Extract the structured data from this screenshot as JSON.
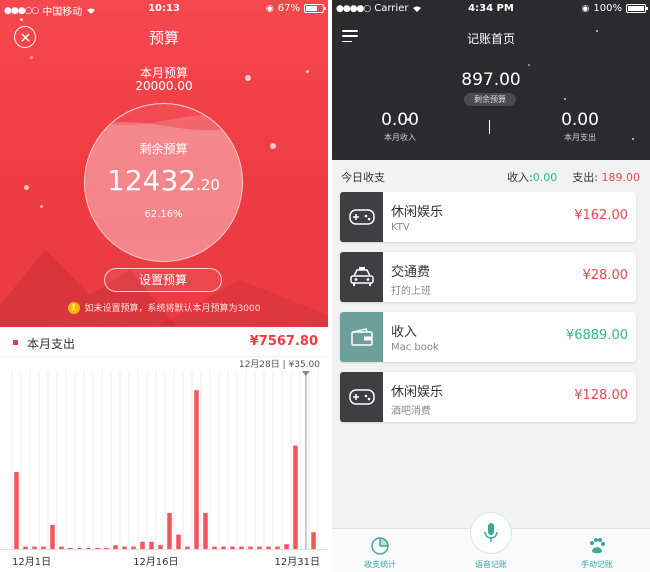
{
  "left": {
    "status_bar": {
      "carrier": "中国移动",
      "time": "10:13",
      "battery": "67%",
      "battery_level": 0.67
    },
    "title": "预算",
    "month_budget": {
      "label": "本月预算",
      "value": "20000.00"
    },
    "remaining": {
      "label": "剩余预算",
      "integer": "12432",
      "decimal": ".20",
      "percent": "62.16%",
      "fill": 0.6216
    },
    "set_budget_label": "设置预算",
    "hint": "如未设置预算，系统将默认本月预算为3000",
    "expense": {
      "label": "本月支出",
      "total": "¥7567.80"
    },
    "chart_data": {
      "type": "bar",
      "title": "",
      "x_tick_labels": [
        "12月1日",
        "12月16日",
        "12月31日"
      ],
      "values": [
        160,
        5,
        5,
        5,
        50,
        5,
        2,
        2,
        2,
        2,
        2,
        8,
        5,
        5,
        15,
        15,
        8,
        75,
        30,
        5,
        330,
        75,
        5,
        5,
        5,
        5,
        5,
        5,
        5,
        5,
        10,
        215,
        0,
        35
      ],
      "ylim": [
        0,
        370
      ],
      "marker": {
        "label": "12月28日 | ¥35.00",
        "index": 33
      },
      "colors": {
        "bar": "#f0575c",
        "grid": "#eeeeee",
        "marker": "#bbbbbb"
      }
    }
  },
  "right": {
    "status_bar": {
      "carrier": "Carrier",
      "time": "4:34 PM",
      "battery": "100%",
      "battery_level": 1.0
    },
    "title": "记账首页",
    "balance": {
      "value": "897.00",
      "label": "剩余预算"
    },
    "income": {
      "value": "0.00",
      "label": "本月收入"
    },
    "expense": {
      "value": "0.00",
      "label": "本月支出"
    },
    "today": {
      "label": "今日收支",
      "income_label": "收入:",
      "income_value": "0.00",
      "expense_label": "支出:",
      "expense_value": "189.00"
    },
    "records": [
      {
        "name": "休闲娱乐",
        "note": "KTV",
        "amount": "¥162.00",
        "icon": "gamepad-icon",
        "type": "expense"
      },
      {
        "name": "交通费",
        "note": "打的上班",
        "amount": "¥28.00",
        "icon": "taxi-icon",
        "type": "expense"
      },
      {
        "name": "收入",
        "note": "Mac book",
        "amount": "¥6889.00",
        "icon": "wallet-icon",
        "type": "income"
      },
      {
        "name": "休闲娱乐",
        "note": "酒吧消费",
        "amount": "¥128.00",
        "icon": "gamepad-icon",
        "type": "expense"
      }
    ],
    "tabs": [
      {
        "label": "收支统计",
        "icon": "pie-chart-icon"
      },
      {
        "label": "语音记账",
        "icon": "microphone-icon"
      },
      {
        "label": "手动记账",
        "icon": "paw-icon"
      }
    ],
    "colors": {
      "expense": "#e8474d",
      "income": "#2db88a",
      "dark_icon_bg": "#3f3f42",
      "income_icon_bg": "#6f9f9b",
      "accent": "#3aa6a0"
    }
  }
}
